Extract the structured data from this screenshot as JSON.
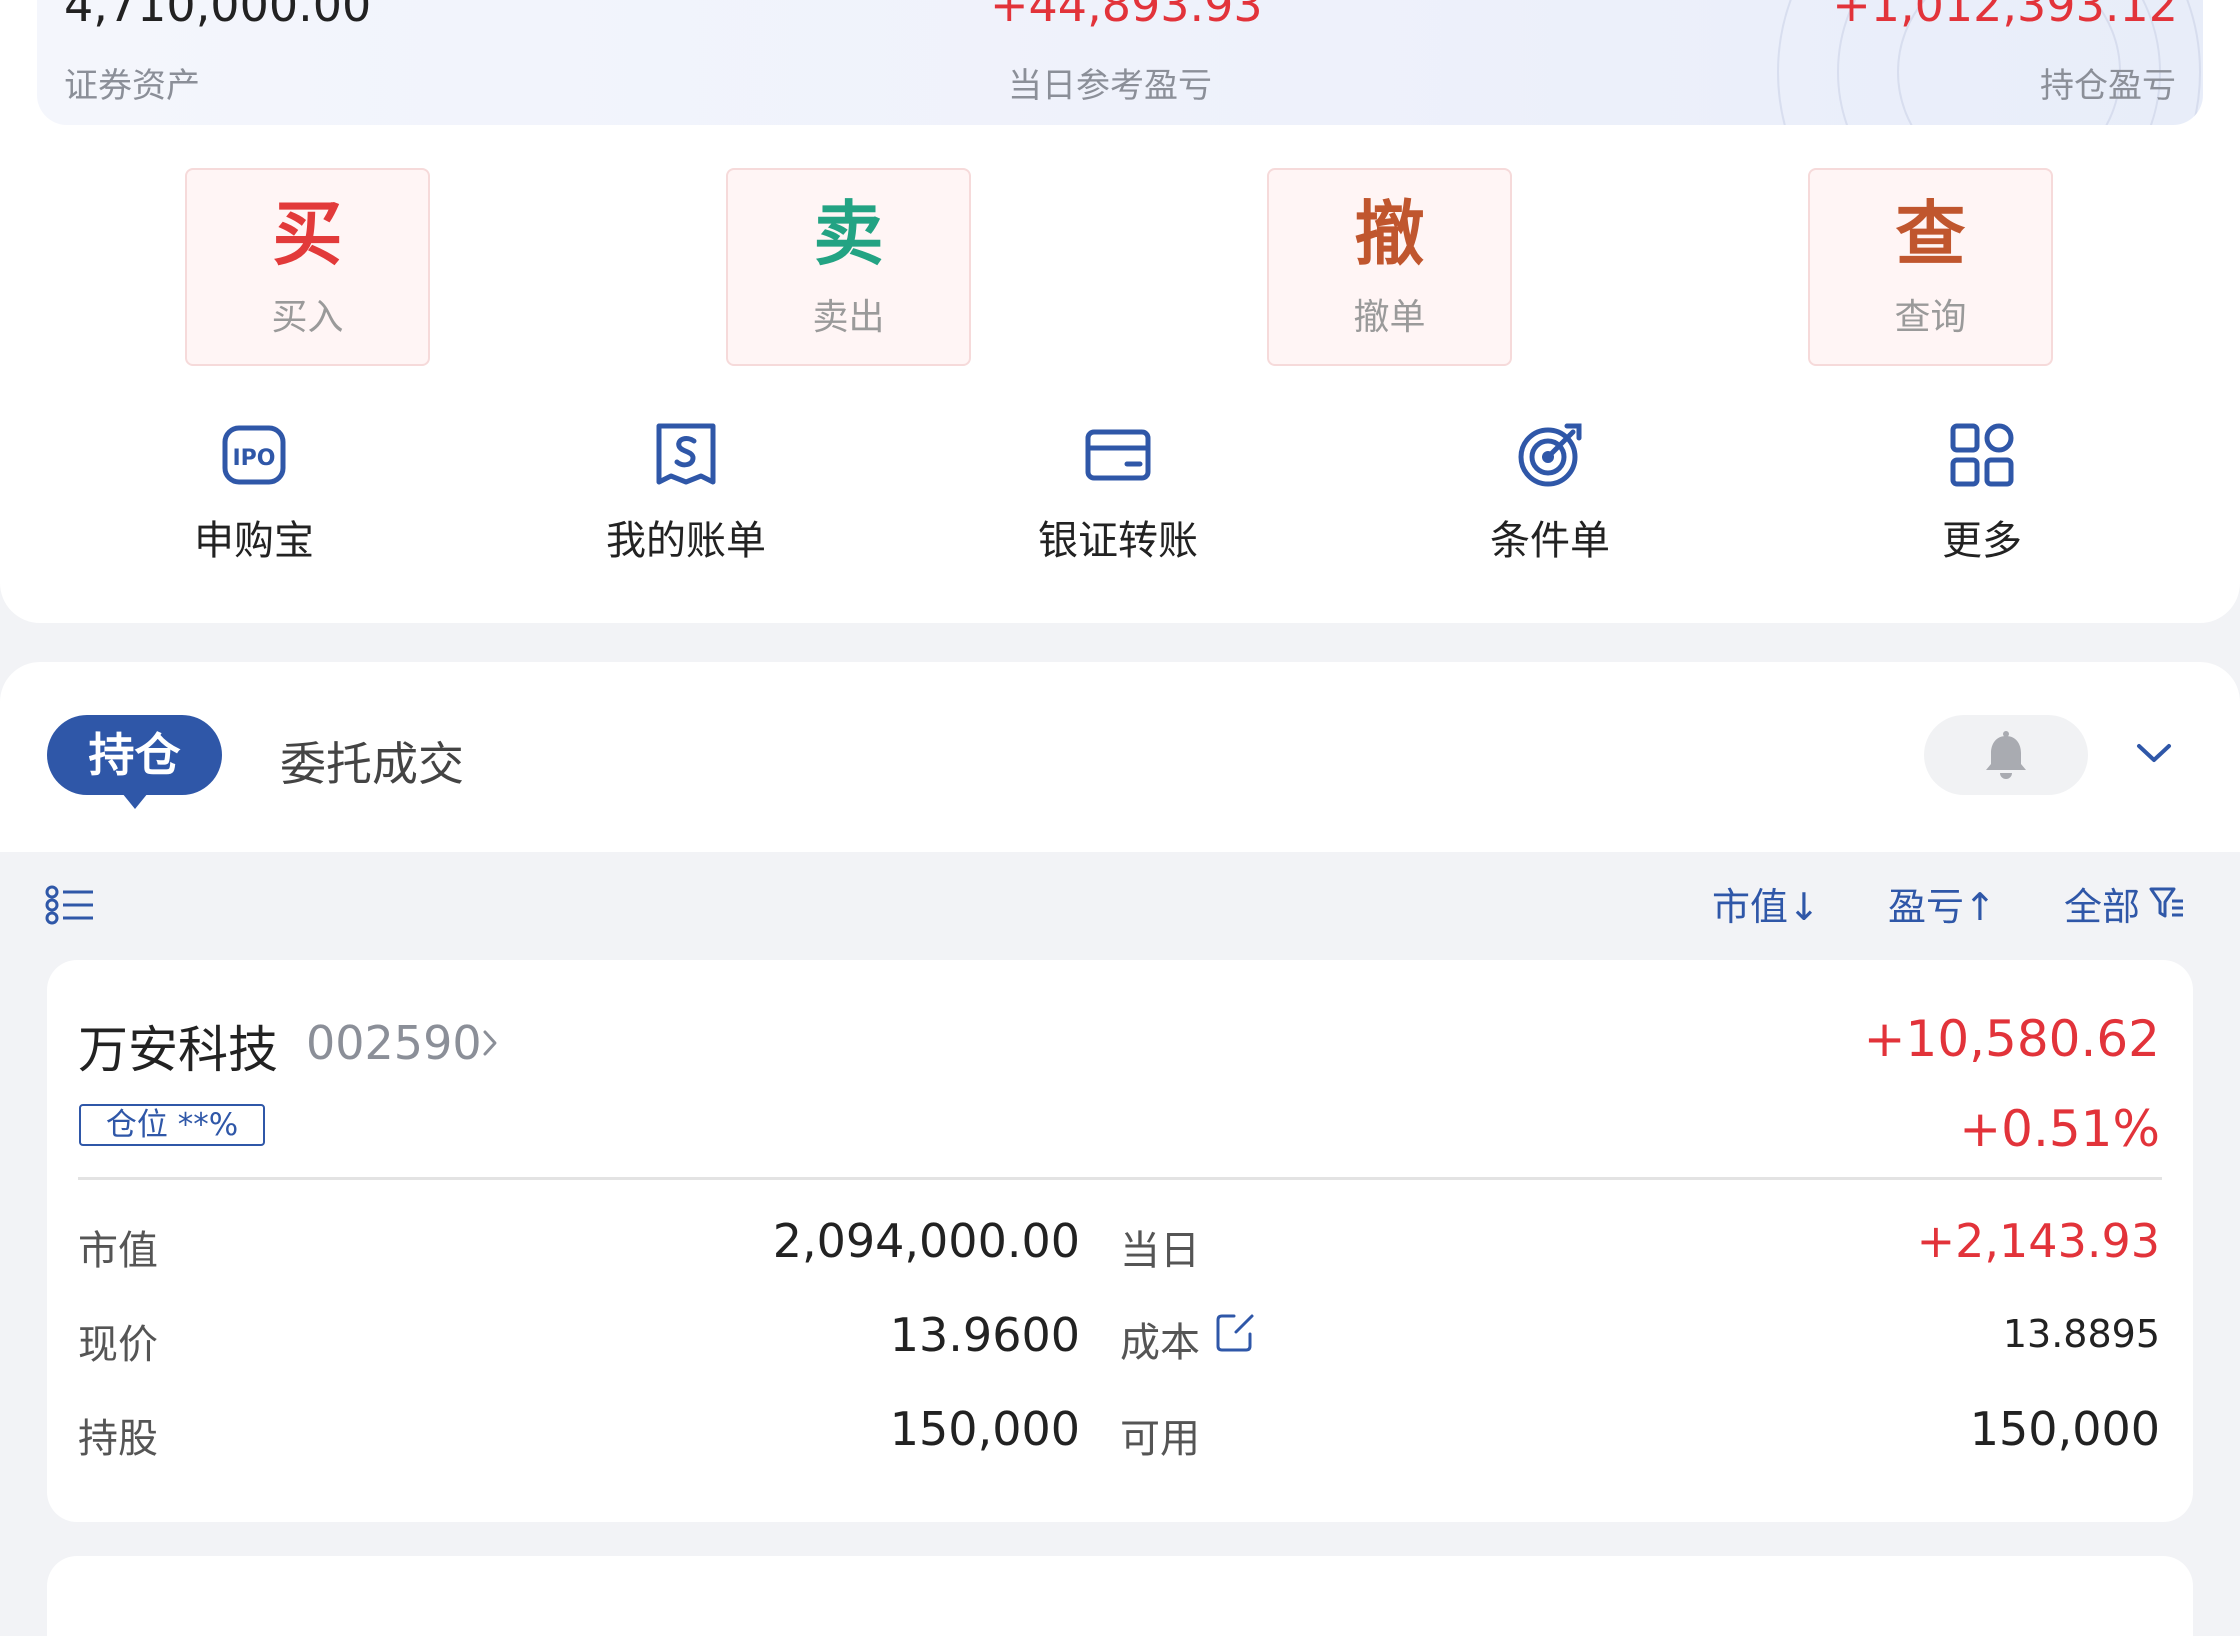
{
  "summary": {
    "assets_value": "4,710,000.00",
    "assets_label": "证券资产",
    "daily_pl_value": "+44,893.93",
    "daily_pl_label": "当日参考盈亏",
    "position_pl_value": "+1,012,393.12",
    "position_pl_label": "持仓盈亏"
  },
  "trade_buttons": [
    {
      "glyph": "买",
      "label": "买入",
      "color": "#e23a3a"
    },
    {
      "glyph": "卖",
      "label": "卖出",
      "color": "#23a383"
    },
    {
      "glyph": "撤",
      "label": "撤单",
      "color": "#c0562e"
    },
    {
      "glyph": "查",
      "label": "查询",
      "color": "#c0562e"
    }
  ],
  "tools": [
    {
      "icon": "ipo-icon",
      "label": "申购宝"
    },
    {
      "icon": "bill-icon",
      "label": "我的账单"
    },
    {
      "icon": "card-icon",
      "label": "银证转账"
    },
    {
      "icon": "target-icon",
      "label": "条件单"
    },
    {
      "icon": "grid-icon",
      "label": "更多"
    }
  ],
  "tabs": {
    "active": "持仓",
    "other": "委托成交"
  },
  "filters": {
    "market_value": "市值↓",
    "profit": "盈亏↑",
    "all": "全部"
  },
  "stock": {
    "name": "万安科技",
    "code": "002590",
    "badge": "仓位 **%",
    "profit": "+10,580.62",
    "profit_pct": "+0.51%",
    "market_value_label": "市值",
    "market_value": "2,094,000.00",
    "today_label": "当日",
    "today": "+2,143.93",
    "price_label": "现价",
    "price": "13.9600",
    "cost_label": "成本",
    "cost": "13.8895",
    "shares_label": "持股",
    "shares": "150,000",
    "available_label": "可用",
    "available": "150,000"
  },
  "colors": {
    "accent_blue": "#2f57a8",
    "profit_red": "#e2333a",
    "sell_green": "#23a383"
  }
}
